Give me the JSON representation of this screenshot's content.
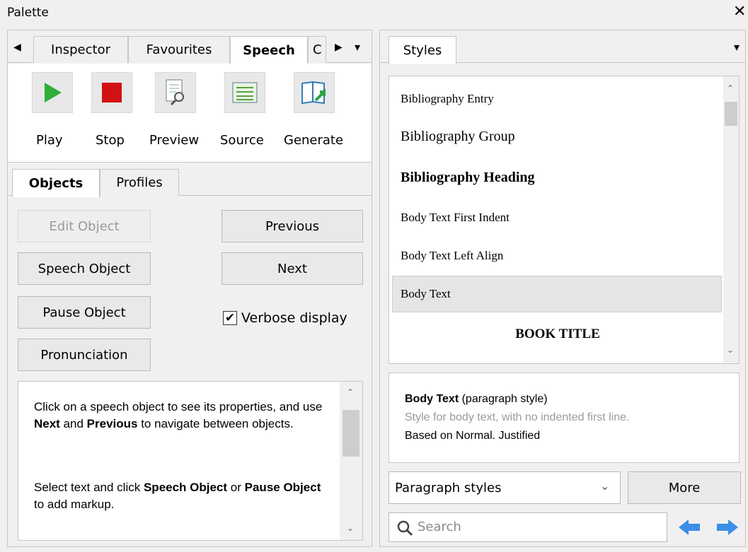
{
  "window": {
    "title": "Palette",
    "close_glyph": "✕"
  },
  "left": {
    "tabs": [
      "Inspector",
      "Favourites",
      "Speech",
      "C"
    ],
    "active_tab": "Speech",
    "toolbar": [
      {
        "label": "Play",
        "icon": "play-icon"
      },
      {
        "label": "Stop",
        "icon": "stop-icon"
      },
      {
        "label": "Preview",
        "icon": "preview-icon"
      },
      {
        "label": "Source",
        "icon": "source-icon"
      },
      {
        "label": "Generate",
        "icon": "generate-icon"
      }
    ],
    "subtabs": [
      "Objects",
      "Profiles"
    ],
    "buttons": {
      "edit_object": "Edit Object",
      "previous": "Previous",
      "speech_object": "Speech Object",
      "next": "Next",
      "pause_object": "Pause Object",
      "pronunciation": "Pronunciation"
    },
    "verbose": {
      "label": "Verbose display",
      "checked": true
    },
    "help": {
      "p1_a": "Click on a speech object to see its properties, and use ",
      "p1_b": "Next",
      "p1_c": " and ",
      "p1_d": "Previous",
      "p1_e": " to navigate between objects.",
      "p2_a": "Select text and click ",
      "p2_b": "Speech Object",
      "p2_c": " or ",
      "p2_d": "Pause Object",
      "p2_e": " to add markup."
    }
  },
  "right": {
    "tab": "Styles",
    "styles": [
      "Bibliography Entry",
      "Bibliography Group",
      "Bibliography Heading",
      "Body Text First Indent",
      "Body Text Left Align",
      "Body Text",
      "BOOK TITLE"
    ],
    "selected_style": "Body Text",
    "description": {
      "name": "Body Text",
      "type": " (paragraph style)",
      "desc": "Style for body text, with no indented first line.",
      "based": "Based on Normal. Justified"
    },
    "dropdown": "Paragraph styles",
    "more": "More",
    "search_placeholder": "Search",
    "accent": "#3c8ee6"
  }
}
